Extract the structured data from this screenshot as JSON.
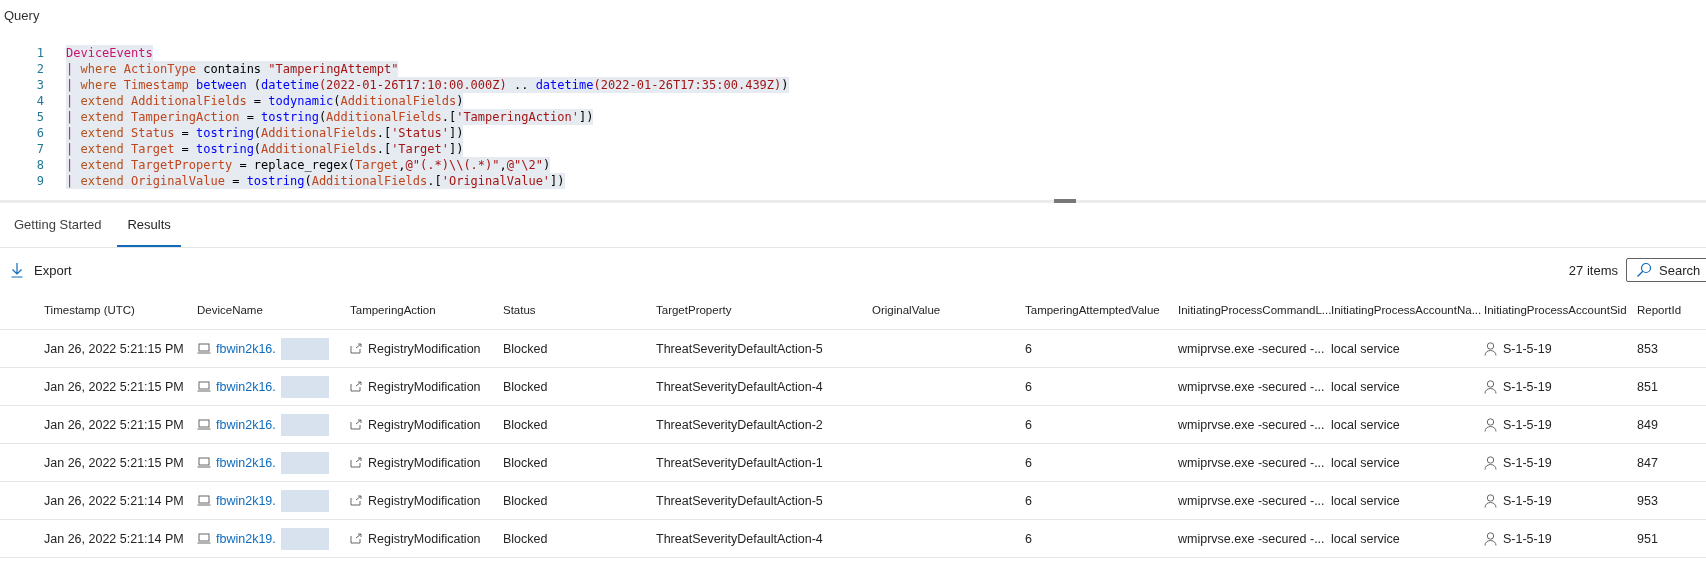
{
  "query": {
    "title": "Query",
    "lines": [
      {
        "number": "1",
        "tokens": [
          {
            "kind": "table",
            "text": "DeviceEvents"
          }
        ]
      },
      {
        "number": "2",
        "tokens": [
          {
            "kind": "pipe",
            "text": "| "
          },
          {
            "kind": "op",
            "text": "where "
          },
          {
            "kind": "col",
            "text": "ActionType "
          },
          {
            "kind": "plain",
            "text": "contains "
          },
          {
            "kind": "str",
            "text": "\"TamperingAttempt\""
          }
        ]
      },
      {
        "number": "3",
        "tokens": [
          {
            "kind": "pipe",
            "text": "| "
          },
          {
            "kind": "op",
            "text": "where "
          },
          {
            "kind": "col",
            "text": "Timestamp "
          },
          {
            "kind": "fn",
            "text": "between "
          },
          {
            "kind": "plain",
            "text": "("
          },
          {
            "kind": "fn",
            "text": "datetime"
          },
          {
            "kind": "str",
            "text": "(2022-01-26T17:10:00.000Z)"
          },
          {
            "kind": "plain",
            "text": " .. "
          },
          {
            "kind": "fn",
            "text": "datetime"
          },
          {
            "kind": "str",
            "text": "(2022-01-26T17:35:00.439Z)"
          },
          {
            "kind": "plain",
            "text": ")"
          }
        ]
      },
      {
        "number": "4",
        "tokens": [
          {
            "kind": "pipe",
            "text": "| "
          },
          {
            "kind": "op",
            "text": "extend "
          },
          {
            "kind": "col",
            "text": "AdditionalFields "
          },
          {
            "kind": "plain",
            "text": "= "
          },
          {
            "kind": "fn",
            "text": "todynamic"
          },
          {
            "kind": "plain",
            "text": "("
          },
          {
            "kind": "col",
            "text": "AdditionalFields"
          },
          {
            "kind": "plain",
            "text": ")"
          }
        ]
      },
      {
        "number": "5",
        "tokens": [
          {
            "kind": "pipe",
            "text": "| "
          },
          {
            "kind": "op",
            "text": "extend "
          },
          {
            "kind": "col",
            "text": "TamperingAction "
          },
          {
            "kind": "plain",
            "text": "= "
          },
          {
            "kind": "fn",
            "text": "tostring"
          },
          {
            "kind": "plain",
            "text": "("
          },
          {
            "kind": "col",
            "text": "AdditionalFields"
          },
          {
            "kind": "plain",
            "text": ".["
          },
          {
            "kind": "str",
            "text": "'TamperingAction'"
          },
          {
            "kind": "plain",
            "text": "])"
          }
        ]
      },
      {
        "number": "6",
        "tokens": [
          {
            "kind": "pipe",
            "text": "| "
          },
          {
            "kind": "op",
            "text": "extend "
          },
          {
            "kind": "col",
            "text": "Status "
          },
          {
            "kind": "plain",
            "text": "= "
          },
          {
            "kind": "fn",
            "text": "tostring"
          },
          {
            "kind": "plain",
            "text": "("
          },
          {
            "kind": "col",
            "text": "AdditionalFields"
          },
          {
            "kind": "plain",
            "text": ".["
          },
          {
            "kind": "str",
            "text": "'Status'"
          },
          {
            "kind": "plain",
            "text": "])"
          }
        ]
      },
      {
        "number": "7",
        "tokens": [
          {
            "kind": "pipe",
            "text": "| "
          },
          {
            "kind": "op",
            "text": "extend "
          },
          {
            "kind": "col",
            "text": "Target "
          },
          {
            "kind": "plain",
            "text": "= "
          },
          {
            "kind": "fn",
            "text": "tostring"
          },
          {
            "kind": "plain",
            "text": "("
          },
          {
            "kind": "col",
            "text": "AdditionalFields"
          },
          {
            "kind": "plain",
            "text": ".["
          },
          {
            "kind": "str",
            "text": "'Target'"
          },
          {
            "kind": "plain",
            "text": "])"
          }
        ]
      },
      {
        "number": "8",
        "tokens": [
          {
            "kind": "pipe",
            "text": "| "
          },
          {
            "kind": "op",
            "text": "extend "
          },
          {
            "kind": "col",
            "text": "TargetProperty "
          },
          {
            "kind": "plain",
            "text": "= replace_regex("
          },
          {
            "kind": "col",
            "text": "Target"
          },
          {
            "kind": "plain",
            "text": ","
          },
          {
            "kind": "str",
            "text": "@\"(.*)\\\\(.*)\""
          },
          {
            "kind": "plain",
            "text": ","
          },
          {
            "kind": "str",
            "text": "@\"\\2\""
          },
          {
            "kind": "plain",
            "text": ")"
          }
        ]
      },
      {
        "number": "9",
        "tokens": [
          {
            "kind": "pipe",
            "text": "| "
          },
          {
            "kind": "op",
            "text": "extend "
          },
          {
            "kind": "col",
            "text": "OriginalValue "
          },
          {
            "kind": "plain",
            "text": "= "
          },
          {
            "kind": "fn",
            "text": "tostring"
          },
          {
            "kind": "plain",
            "text": "("
          },
          {
            "kind": "col",
            "text": "AdditionalFields"
          },
          {
            "kind": "plain",
            "text": ".["
          },
          {
            "kind": "str",
            "text": "'OriginalValue'"
          },
          {
            "kind": "plain",
            "text": "])"
          }
        ]
      }
    ]
  },
  "tabs": [
    {
      "label": "Getting Started",
      "selected": false
    },
    {
      "label": "Results",
      "selected": true
    }
  ],
  "toolbar": {
    "export": "Export",
    "count": "27 items",
    "search": {
      "placeholder": "Search"
    }
  },
  "table": {
    "columns": [
      "Timestamp (UTC)",
      "DeviceName",
      "TamperingAction",
      "Status",
      "TargetProperty",
      "OriginalValue",
      "TamperingAttemptedValue",
      "InitiatingProcessCommandL...",
      "InitiatingProcessAccountNa...",
      "InitiatingProcessAccountSid",
      "ReportId"
    ],
    "rows": [
      {
        "timestamp": "Jan 26, 2022 5:21:15 PM",
        "device": "fbwin2k16.",
        "action": "RegistryModification",
        "status": "Blocked",
        "target_property": "ThreatSeverityDefaultAction-5",
        "attempted_value": "6",
        "command_line": "wmiprvse.exe -secured -...",
        "account_name": "local service",
        "account_sid": "S-1-5-19",
        "report_id": "853"
      },
      {
        "timestamp": "Jan 26, 2022 5:21:15 PM",
        "device": "fbwin2k16.",
        "action": "RegistryModification",
        "status": "Blocked",
        "target_property": "ThreatSeverityDefaultAction-4",
        "attempted_value": "6",
        "command_line": "wmiprvse.exe -secured -...",
        "account_name": "local service",
        "account_sid": "S-1-5-19",
        "report_id": "851"
      },
      {
        "timestamp": "Jan 26, 2022 5:21:15 PM",
        "device": "fbwin2k16.",
        "action": "RegistryModification",
        "status": "Blocked",
        "target_property": "ThreatSeverityDefaultAction-2",
        "attempted_value": "6",
        "command_line": "wmiprvse.exe -secured -...",
        "account_name": "local service",
        "account_sid": "S-1-5-19",
        "report_id": "849"
      },
      {
        "timestamp": "Jan 26, 2022 5:21:15 PM",
        "device": "fbwin2k16.",
        "action": "RegistryModification",
        "status": "Blocked",
        "target_property": "ThreatSeverityDefaultAction-1",
        "attempted_value": "6",
        "command_line": "wmiprvse.exe -secured -...",
        "account_name": "local service",
        "account_sid": "S-1-5-19",
        "report_id": "847"
      },
      {
        "timestamp": "Jan 26, 2022 5:21:14 PM",
        "device": "fbwin2k19.",
        "action": "RegistryModification",
        "status": "Blocked",
        "target_property": "ThreatSeverityDefaultAction-5",
        "attempted_value": "6",
        "command_line": "wmiprvse.exe -secured -...",
        "account_name": "local service",
        "account_sid": "S-1-5-19",
        "report_id": "953"
      },
      {
        "timestamp": "Jan 26, 2022 5:21:14 PM",
        "device": "fbwin2k19.",
        "action": "RegistryModification",
        "status": "Blocked",
        "target_property": "ThreatSeverityDefaultAction-4",
        "attempted_value": "6",
        "command_line": "wmiprvse.exe -secured -...",
        "account_name": "local service",
        "account_sid": "S-1-5-19",
        "report_id": "951"
      }
    ]
  }
}
